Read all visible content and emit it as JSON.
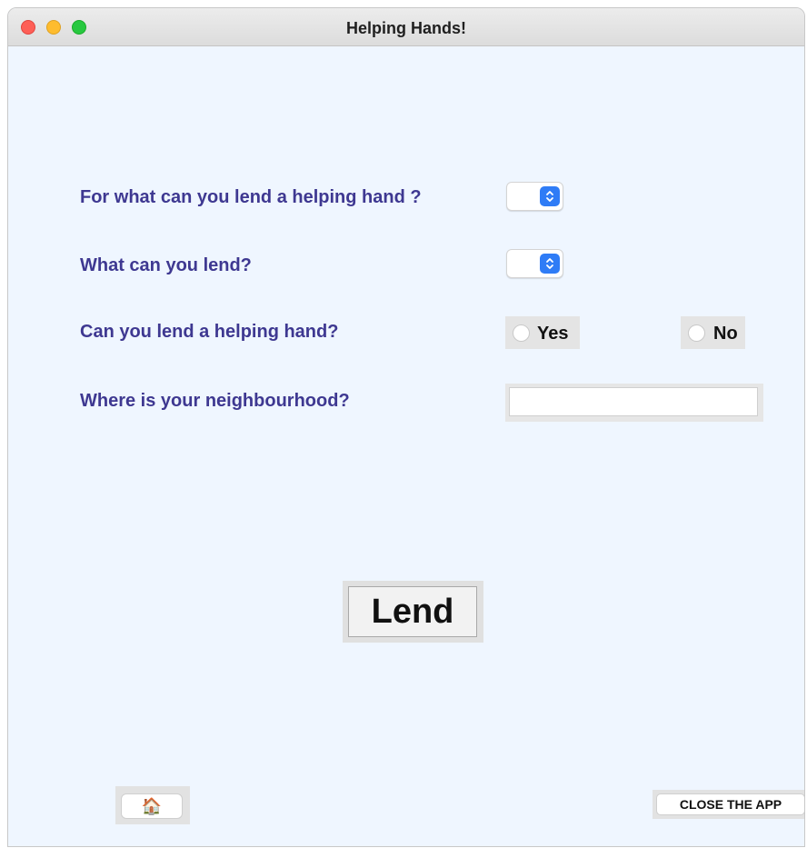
{
  "window": {
    "title": "Helping Hands!"
  },
  "form": {
    "question_help_type": "For what can you lend a helping hand ?",
    "help_type_selected": "",
    "question_item": "What can you lend?",
    "item_selected": "",
    "question_can_help": "Can you lend a helping hand?",
    "yes_label": "Yes",
    "no_label": "No",
    "question_neighbourhood": "Where is your neighbourhood?",
    "neighbourhood_value": ""
  },
  "actions": {
    "lend_label": "Lend",
    "home_icon": "🏠",
    "close_label": "CLOSE THE APP"
  },
  "colors": {
    "label_text": "#3e3891",
    "background": "#eff6ff",
    "accent_blue": "#2f7cf6"
  },
  "icons": {
    "home": "house-icon",
    "dropdown": "chevron-updown-icon"
  }
}
